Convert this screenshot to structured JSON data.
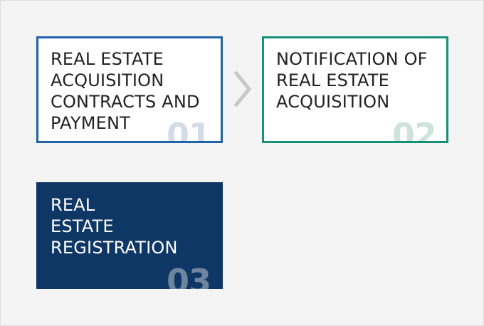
{
  "diagram": {
    "steps": [
      {
        "title": "REAL ESTATE\nACQUISITION\nCONTRACTS AND\n PAYMENT",
        "number": "01",
        "border_color": "#1f64a8",
        "number_color": "#d3dbe7"
      },
      {
        "title": "NOTIFICATION OF\nREAL ESTATE\nACQUISITION",
        "number": "02",
        "border_color": "#169179",
        "number_color": "#cfe3dd"
      },
      {
        "title": "REAL\nESTATE\nREGISTRATION",
        "number": "03",
        "background_color": "#0f3765",
        "number_color": "#6e859f"
      }
    ],
    "connector_icon": "chevron-right-icon",
    "connector_color": "#c8c8c8",
    "background_color": "#f4f4f4"
  }
}
